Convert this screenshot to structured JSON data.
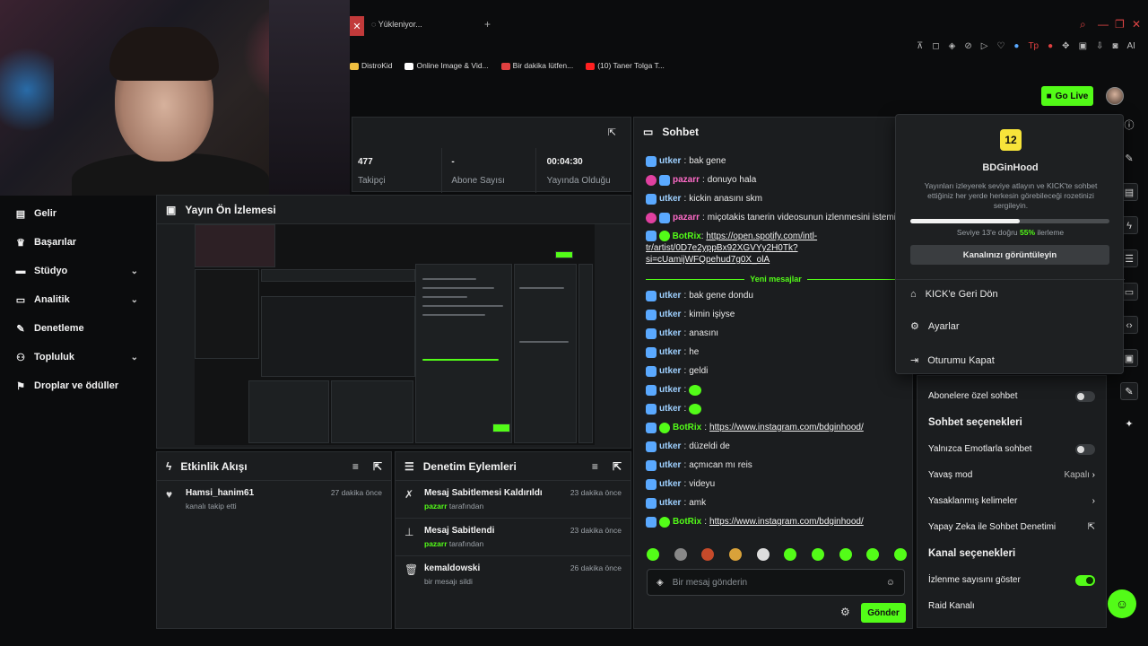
{
  "browser": {
    "tab_title": "Yükleniyor...",
    "tab_close": "✕",
    "tab_plus": "+",
    "bookmarks": [
      "DistroKid",
      "Online Image & Vid...",
      "Bir dakika lütfen...",
      "(10) Taner Tolga T..."
    ],
    "tools_ai": "AI"
  },
  "header": {
    "go_live": "Go Live"
  },
  "sidebar": {
    "items": [
      {
        "label": "Gelir",
        "icon": "wallet-icon"
      },
      {
        "label": "Başarılar",
        "icon": "trophy-icon"
      },
      {
        "label": "Stüdyo",
        "icon": "studio-icon"
      },
      {
        "label": "Analitik",
        "icon": "chart-icon"
      },
      {
        "label": "Denetleme",
        "icon": "wrench-icon"
      },
      {
        "label": "Topluluk",
        "icon": "people-icon"
      },
      {
        "label": "Droplar ve ödüller",
        "icon": "gift-icon"
      }
    ]
  },
  "stats": {
    "followers": {
      "value": "477",
      "label": "Takipçi"
    },
    "subs": {
      "value": "-",
      "label": "Abone Sayısı"
    },
    "uptime": {
      "value": "00:04:30",
      "label": "Yayında Olduğu"
    }
  },
  "preview": {
    "title": "Yayın Ön İzlemesi"
  },
  "feed": {
    "title": "Etkinlik Akışı",
    "items": [
      {
        "name": "Hamsi_hanim61",
        "desc": "kanalı takip etti",
        "time": "27 dakika önce"
      }
    ]
  },
  "modlog": {
    "title": "Denetim Eylemleri",
    "items": [
      {
        "title": "Mesaj Sabitlemesi Kaldırıldı",
        "user": "pazarr",
        "suffix": "tarafından",
        "time": "23 dakika önce"
      },
      {
        "title": "Mesaj Sabitlendi",
        "user": "pazarr",
        "suffix": "tarafından",
        "time": "23 dakika önce"
      },
      {
        "title": "kemaldowski",
        "user": "",
        "suffix": "bir mesajı sildi",
        "time": "26 dakika önce"
      }
    ]
  },
  "chat": {
    "title": "Sohbet",
    "messages_before": [
      {
        "user": "utker",
        "text": "bak gene",
        "badge": "b"
      },
      {
        "user": "pazarr",
        "text": "donuyo hala",
        "badge": "p"
      },
      {
        "user": "utker",
        "text": "kickin anasını skm",
        "badge": "b"
      },
      {
        "user": "pazarr",
        "text": "miçotakis tanerin videosunun izlenmesini istemiy",
        "badge": "p"
      }
    ],
    "botrix1": {
      "user": "BotRix",
      "link1": "https://open.spotify.com/intl-",
      "link2": "tr/artist/0D7e2yppBx92XGVYy2H0Tk?",
      "link3": "si=cUamijWFQpehud7g0X_olA"
    },
    "new_messages": "Yeni mesajlar",
    "messages_after": [
      {
        "user": "utker",
        "text": "bak gene dondu"
      },
      {
        "user": "utker",
        "text": "kimin işiyse"
      },
      {
        "user": "utker",
        "text": "anasını"
      },
      {
        "user": "utker",
        "text": "he"
      },
      {
        "user": "utker",
        "text": "geldi"
      }
    ],
    "bot_user": "BotRix",
    "insta": "https://www.instagram.com/bdginhood/",
    "messages_after2": [
      {
        "user": "utker",
        "text": "düzeldi de"
      },
      {
        "user": "utker",
        "text": "açmıcan mı reis"
      },
      {
        "user": "utker",
        "text": "videyu"
      },
      {
        "user": "utker",
        "text": "amk"
      }
    ],
    "emote_user": "utker",
    "placeholder": "Bir mesaj gönderin",
    "send": "Gönder"
  },
  "settings": {
    "subs_only": "Abonelere özel sohbet",
    "chat_options": "Sohbet seçenekleri",
    "emotes_only": "Yalnızca Emotlarla sohbet",
    "slow_mode": "Yavaş mod",
    "slow_value": "Kapalı",
    "banned_words": "Yasaklanmış kelimeler",
    "ai_mod": "Yapay Zeka ile Sohbet Denetimi",
    "channel_options": "Kanal seçenekleri",
    "show_views": "İzlenme sayısını göster",
    "raid": "Raid Kanalı"
  },
  "dropdown": {
    "level": "12",
    "name": "BDGinHood",
    "desc": "Yayınları izleyerek seviye atlayın ve KICK'te sohbet ettiğiniz her yerde herkesin görebileceği rozetinizi sergileyin.",
    "progress_pre": "Seviye 13'e doğru",
    "progress_pct": "55%",
    "progress_post": "ilerleme",
    "progress_value": 0.55,
    "view_channel": "Kanalınızı görüntüleyin",
    "back": "KICK'e Geri Dön",
    "settings": "Ayarlar",
    "logout": "Oturumu Kapat"
  },
  "colors": {
    "accent": "#53fc18",
    "panel": "#1b1d1f",
    "bg": "#0b0c0d"
  }
}
